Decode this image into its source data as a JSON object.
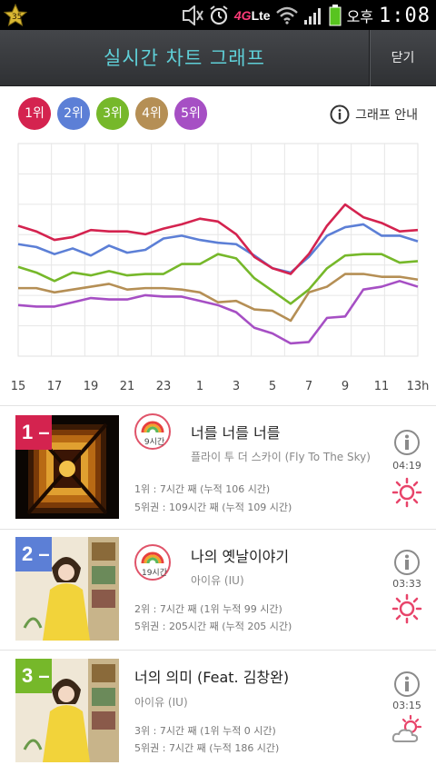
{
  "status_bar": {
    "badge_count": "35",
    "network": "Lte",
    "network_prefix": "4G",
    "ampm": "오후",
    "time": "1:08",
    "icons": [
      "notification-star-icon",
      "mute-icon",
      "alarm-icon",
      "wifi-icon",
      "signal-icon",
      "battery-icon"
    ]
  },
  "header": {
    "title": "실시간 차트 그래프",
    "close_label": "닫기"
  },
  "ranks": [
    {
      "label": "1위",
      "color": "#d4234f"
    },
    {
      "label": "2위",
      "color": "#5c7fd6"
    },
    {
      "label": "3위",
      "color": "#76b82a"
    },
    {
      "label": "4위",
      "color": "#b58f55"
    },
    {
      "label": "5위",
      "color": "#a64fc4"
    }
  ],
  "guide_label": "그래프 안내",
  "chart_data": {
    "type": "line",
    "x": [
      "15",
      "16",
      "17",
      "18",
      "19",
      "20",
      "21",
      "22",
      "23",
      "24",
      "1",
      "2",
      "3",
      "4",
      "5",
      "6",
      "7",
      "8",
      "9",
      "10",
      "11",
      "12",
      "13h"
    ],
    "x_tick_labels": [
      "15",
      "17",
      "19",
      "21",
      "23",
      "1",
      "3",
      "5",
      "7",
      "9",
      "11",
      "13h"
    ],
    "series": [
      {
        "name": "1위",
        "color": "#d4234f",
        "values": [
          92,
          88,
          82,
          84,
          89,
          88,
          88,
          86,
          90,
          93,
          97,
          95,
          86,
          70,
          62,
          58,
          72,
          92,
          107,
          98,
          94,
          88,
          89
        ]
      },
      {
        "name": "2위",
        "color": "#5c7fd6",
        "values": [
          79,
          77,
          72,
          76,
          71,
          78,
          73,
          75,
          83,
          85,
          82,
          80,
          79,
          71,
          62,
          59,
          70,
          85,
          91,
          93,
          85,
          85,
          81
        ]
      },
      {
        "name": "3위",
        "color": "#76b82a",
        "values": [
          63,
          59,
          53,
          59,
          57,
          60,
          57,
          58,
          58,
          65,
          65,
          72,
          69,
          55,
          46,
          37,
          47,
          62,
          71,
          72,
          72,
          66,
          67
        ]
      },
      {
        "name": "4위",
        "color": "#b58f55",
        "values": [
          48,
          48,
          45,
          47,
          49,
          51,
          47,
          48,
          48,
          47,
          45,
          38,
          39,
          33,
          32,
          25,
          45,
          49,
          58,
          58,
          56,
          56,
          54
        ]
      },
      {
        "name": "5위",
        "color": "#a64fc4",
        "values": [
          36,
          35,
          35,
          38,
          41,
          40,
          40,
          43,
          42,
          42,
          39,
          36,
          31,
          20,
          16,
          9,
          10,
          27,
          28,
          47,
          49,
          53,
          49
        ]
      }
    ],
    "ylim": [
      0,
      150
    ],
    "grid": true
  },
  "songs": [
    {
      "rank": "1",
      "rank_color": "#d4234f",
      "hours_badge": "9시간",
      "title": "너를 너를 너를",
      "artist": "플라이 투 더 스카이 (Fly To The Sky)",
      "stat_1": "1위 : 7시간 째 (누적 106 시간)",
      "stat_2": "5위권 : 109시간 째 (누적 109 시간)",
      "time": "04:19",
      "weather_icon": "sun-icon"
    },
    {
      "rank": "2",
      "rank_color": "#5c7fd6",
      "hours_badge": "19시간",
      "title": "나의 옛날이야기",
      "artist": "아이유 (IU)",
      "stat_1": "2위 : 7시간 째 (1위 누적 99 시간)",
      "stat_2": "5위권 : 205시간 째 (누적 205 시간)",
      "time": "03:33",
      "weather_icon": "sun-icon"
    },
    {
      "rank": "3",
      "rank_color": "#76b82a",
      "title": "너의 의미 (Feat. 김창완)",
      "artist": "아이유 (IU)",
      "stat_1": "3위 : 7시간 째 (1위 누적 0 시간)",
      "stat_2": "5위권 : 7시간 째 (누적 186 시간)",
      "time": "03:15",
      "weather_icon": "partly-cloudy-icon"
    }
  ]
}
